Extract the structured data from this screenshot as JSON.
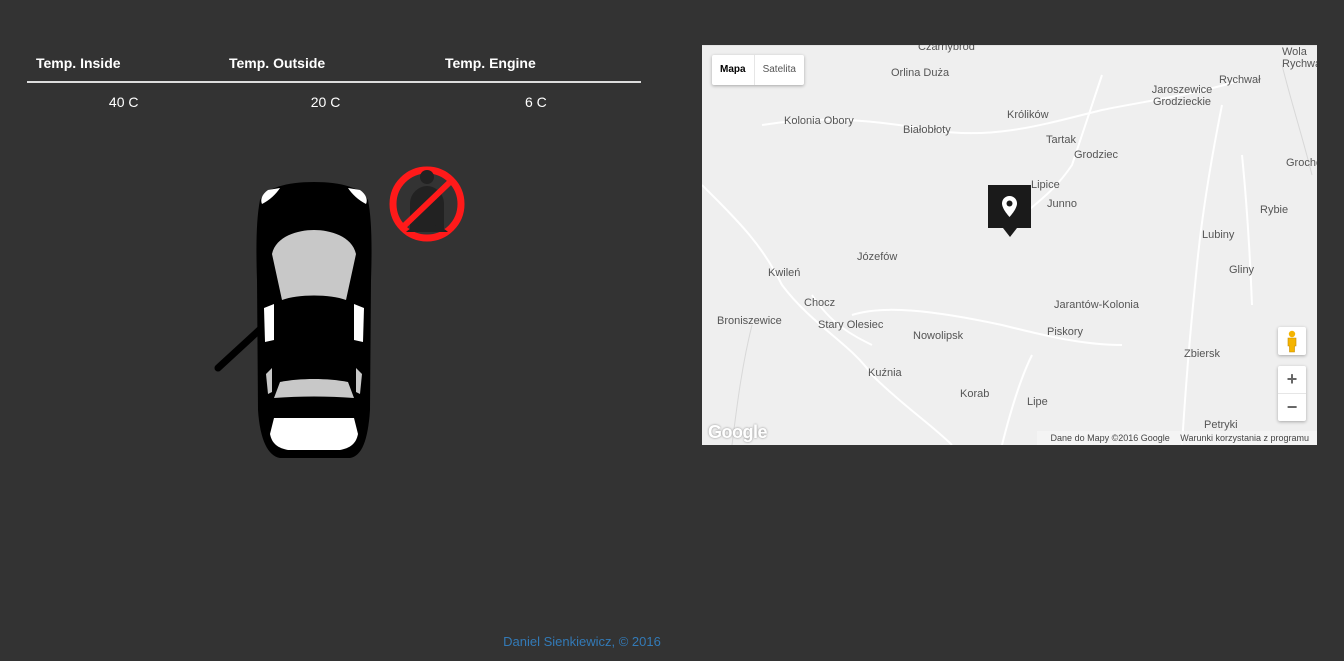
{
  "temps": {
    "headers": [
      "Temp. Inside",
      "Temp. Outside",
      "Temp. Engine"
    ],
    "values": [
      "40 C",
      "20 C",
      "6 C"
    ]
  },
  "car": {
    "door_open": "left-front",
    "seatbelt_warning": true,
    "warning_color": "#ff1a1a"
  },
  "map": {
    "type_buttons": [
      "Mapa",
      "Satelita"
    ],
    "active_type": "Mapa",
    "places": [
      "Czarnybród",
      "Orlina Duża",
      "Kolonia Obory",
      "Białobłoty",
      "Królików",
      "Tartak",
      "Grodziec",
      "Jaroszewice Grodzieckie",
      "Rychwał",
      "Wola Rychwalska",
      "Grochowy",
      "Lipice",
      "Junno",
      "Rybie",
      "Lubiny",
      "Gliny",
      "Józefów",
      "Kwileń",
      "Chocz",
      "Broniszewice",
      "Stary Olesiec",
      "Nowolipsk",
      "Jarantów-Kolonia",
      "Piskory",
      "Zbiersk",
      "Kuźnia",
      "Korab",
      "Lipe",
      "Petryki"
    ],
    "zoom_in": "+",
    "zoom_out": "−",
    "logo": "Google",
    "attribution": "Dane do Mapy ©2016 Google",
    "terms": "Warunki korzystania z programu",
    "marker_icon": "map-pin-icon",
    "pegman_icon": "street-view-pegman-icon"
  },
  "footer": {
    "text": "Daniel Sienkiewicz, © 2016",
    "color": "#337ab7"
  }
}
